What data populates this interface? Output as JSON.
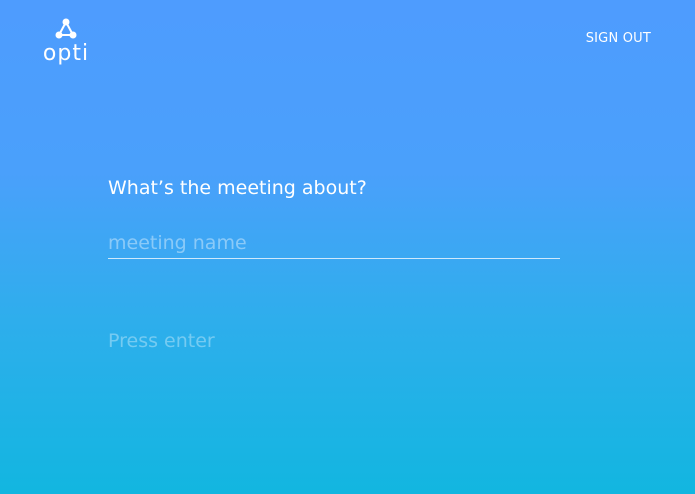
{
  "header": {
    "logo_text": "opti",
    "logo_icon": "molecule-icon",
    "sign_out_label": "SIGN OUT"
  },
  "form": {
    "question": "What’s the meeting about?",
    "input_value": "",
    "input_placeholder": "meeting name",
    "hint": "Press enter"
  },
  "colors": {
    "gradient_top": "#4e9cfe",
    "gradient_bottom": "#12b6e0"
  }
}
